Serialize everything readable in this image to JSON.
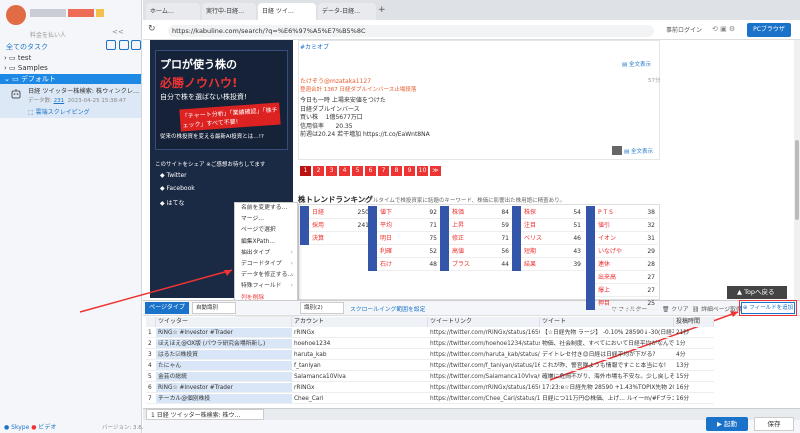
{
  "left": {
    "subtitle": "料金を払い人",
    "collapse": "<<",
    "all_tasks": "全てのタスク",
    "tree": [
      {
        "label": "test"
      },
      {
        "label": "Samples"
      },
      {
        "label": "デフォルト"
      }
    ],
    "task": {
      "title": "日経 ツイッター株検索: 株ウィンクレ…",
      "meta_label": "データ数:",
      "meta_count": "231",
      "meta_date": "2023-04-25 15:38:47",
      "link": "⬚ 雲端スクレイピング"
    },
    "skype": "Skype",
    "site": "ビデオ",
    "version": "バージョン: 3.6.4"
  },
  "tabs": [
    {
      "label": "ホーム…"
    },
    {
      "label": "実行中-日経…"
    },
    {
      "label": "日経 ツイ…"
    },
    {
      "label": "データ-日経…"
    },
    {
      "label": "+"
    }
  ],
  "url": "https://kabuline.com/search/?q=%E6%97%A5%E7%B5%8C",
  "login_label": "事前ログイン",
  "pc_browser_label": "PCブラウザ",
  "ad": {
    "h1": "プロが使う株の",
    "h2": "必勝ノウハウ!",
    "h3": "自分で株を選ばない株投資!",
    "red": "「チャート分析」「業績確認」「株チェック」すべて不要!",
    "foot": "従来の株投資を変える最新AI投資とは…!?",
    "share_heading": "このサイトをシェア ※ご感想お待ちしてます",
    "share": [
      {
        "label": "Twitter"
      },
      {
        "label": "Facebook"
      },
      {
        "label": "はてな"
      }
    ]
  },
  "tweet": {
    "top_text": "#カミオブ",
    "full_label": "全文表示",
    "name": "たけぞう@mzataka1127",
    "sub": "登週合計 1367 日経ダブルインバース止場段落",
    "time": "57分",
    "body": "今日も一時 上場来安値をつけた\n日経ダブルインバース\n買い株    1億5677万口\n信用倍率      20.35\n前週は20.24 若干増加 https://t.co/EaWnt8NA"
  },
  "pager": [
    "1",
    "2",
    "3",
    "4",
    "5",
    "6",
    "7",
    "8",
    "9",
    "10",
    "≫"
  ],
  "trend": {
    "heading": "株トレンドランキング",
    "desc": "リアルタイムで株投資家に話題のキーワード、株価に影響出た株用語に精査あり。",
    "cols": [
      [
        [
          "日経",
          "250"
        ],
        [
          "採用",
          "241"
        ],
        [
          "決算",
          ""
        ]
      ],
      [
        [
          "値下",
          "92"
        ],
        [
          "平均",
          "71"
        ],
        [
          "明日",
          "75"
        ],
        [
          "利確",
          "52"
        ],
        [
          "石け",
          "48"
        ]
      ],
      [
        [
          "株価",
          "84"
        ],
        [
          "上昇",
          "59"
        ],
        [
          "修正",
          "71"
        ],
        [
          "高値",
          "56"
        ],
        [
          "プラス",
          "44"
        ]
      ],
      [
        [
          "株探",
          "54"
        ],
        [
          "注目",
          "51"
        ],
        [
          "ベリス",
          "46"
        ],
        [
          "短期",
          "43"
        ],
        [
          "結果",
          "39"
        ]
      ],
      [
        [
          "P T S",
          "38"
        ],
        [
          "値引",
          "32"
        ],
        [
          "イオン",
          "31"
        ],
        [
          "いなげや",
          "29"
        ],
        [
          "連休",
          "28"
        ],
        [
          "出来高",
          "27"
        ],
        [
          "爆上",
          "27"
        ],
        [
          "押目",
          "25"
        ]
      ]
    ]
  },
  "top_button": "Topへ戻る",
  "context_menu": [
    {
      "label": "名前を変更する…",
      "arrow": ""
    },
    {
      "label": "マージ…",
      "arrow": ""
    },
    {
      "label": "ページで選択",
      "arrow": ""
    },
    {
      "label": "編集XPath…",
      "arrow": ""
    },
    {
      "label": "抽出タイプ",
      "arrow": "›"
    },
    {
      "label": "デコードタイプ",
      "arrow": "›"
    },
    {
      "label": "データを修正する…",
      "arrow": "›"
    },
    {
      "label": "特殊フィールド",
      "arrow": "›"
    },
    {
      "label": "列を削除",
      "arrow": ""
    }
  ],
  "toolbar": {
    "page_type": "ページタイプ",
    "select1": "自動識別",
    "select2": "識別(2)",
    "scroll_link": "スクロールイング範囲を設定",
    "filter": "フィルター",
    "clear": "クリア",
    "detail": "詳細ページ取得",
    "add_field": "フィールドを追加"
  },
  "grid": {
    "headers": [
      "",
      "ツイッター",
      "アカウント",
      "ツイートリンク",
      "ツイート",
      "投稿時間"
    ],
    "rows": [
      [
        "1",
        "RiNG☆ #Investor #Trader",
        "rRINGx",
        "https://twitter.com/rRINGx/status/165078182744263…",
        "【☆日経先物 ラージ】 -0.10% 28590↓-30(日経平均…",
        "21秒"
      ],
      [
        "2",
        "ほえほえ@OX版 (パウラ研究会場所新し)",
        "hoehoe1234",
        "https://twitter.com/hoehoe1234/status/1650781809223…",
        "物価、社会制度、すべてにおいて日経平均がなんでも…",
        "1分"
      ],
      [
        "3",
        "はるた☑株投資",
        "haruta_kab",
        "https://twitter.com/haruta_kab/status/1650780851333…",
        "デイトレセ付き😊日経は日経平均が下がる?",
        "4分"
      ],
      [
        "4",
        "たにゃん",
        "f_taniyan",
        "https://twitter.com/f_taniyan/status/1650778450641…",
        "これが昨、警官隊ようも情報ですこと本当にな!",
        "13分"
      ],
      [
        "5",
        "金芸の総統",
        "Salamanca10Viva",
        "https://twitter.com/Salamanca10Viva/status/1650777…",
        "確嫌に危岡不がり、海外市場も不安な。少し戻しそうで…",
        "15分"
      ],
      [
        "6",
        "RiNG☆ #Investor #Trader",
        "rRINGx",
        "https://twitter.com/rRINGx/status/165077573556…",
        "17:23:e☆日経先物 28590 +1.43%TOPIX先物 2035…",
        "16分"
      ],
      [
        "7",
        "チーカル@個別株投",
        "Chee_Cari",
        "https://twitter.com/Chee_Cari/status/165077558…",
        "日経につ11万円😊株価、上げ… ルイ一m/#Fブラス株主…",
        "16分"
      ]
    ]
  },
  "status_tab": "1 日経 ツイッター株検索: 株ウ…",
  "run_label": "▶ 起動",
  "save_label": "保存",
  "colors": {
    "accent": "#1a73c9",
    "highlight": "#e33333"
  }
}
